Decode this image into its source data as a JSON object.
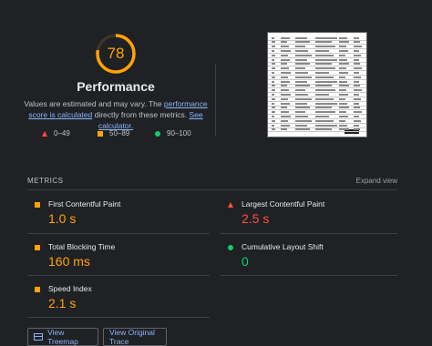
{
  "performance": {
    "score": "78",
    "score_fraction": 0.78,
    "title": "Performance",
    "desc_prefix": "Values are estimated and may vary. The ",
    "desc_link1": "performance score is calculated",
    "desc_mid": " directly from these metrics. ",
    "desc_link2": "See calculator.",
    "legend": [
      {
        "range": "0–49",
        "shape": "triangle",
        "color": "#ff4e42"
      },
      {
        "range": "50–89",
        "shape": "square",
        "color": "#ffa400"
      },
      {
        "range": "90–100",
        "shape": "circle",
        "color": "#0cce6b"
      }
    ]
  },
  "metrics": {
    "header": "METRICS",
    "expand_label": "Expand view",
    "items": [
      {
        "label": "First Contentful Paint",
        "value": "1.0 s",
        "status": "average"
      },
      {
        "label": "Largest Contentful Paint",
        "value": "2.5 s",
        "status": "fail"
      },
      {
        "label": "Total Blocking Time",
        "value": "160 ms",
        "status": "average"
      },
      {
        "label": "Cumulative Layout Shift",
        "value": "0",
        "status": "pass"
      },
      {
        "label": "Speed Index",
        "value": "2.1 s",
        "status": "average"
      }
    ]
  },
  "actions": {
    "treemap_label": "View Treemap",
    "trace_label": "View Original Trace"
  },
  "colors": {
    "background": "#202124",
    "average": "#ffa400",
    "fail": "#ff4e42",
    "pass": "#0cce6b",
    "link": "#8ab4f8"
  }
}
